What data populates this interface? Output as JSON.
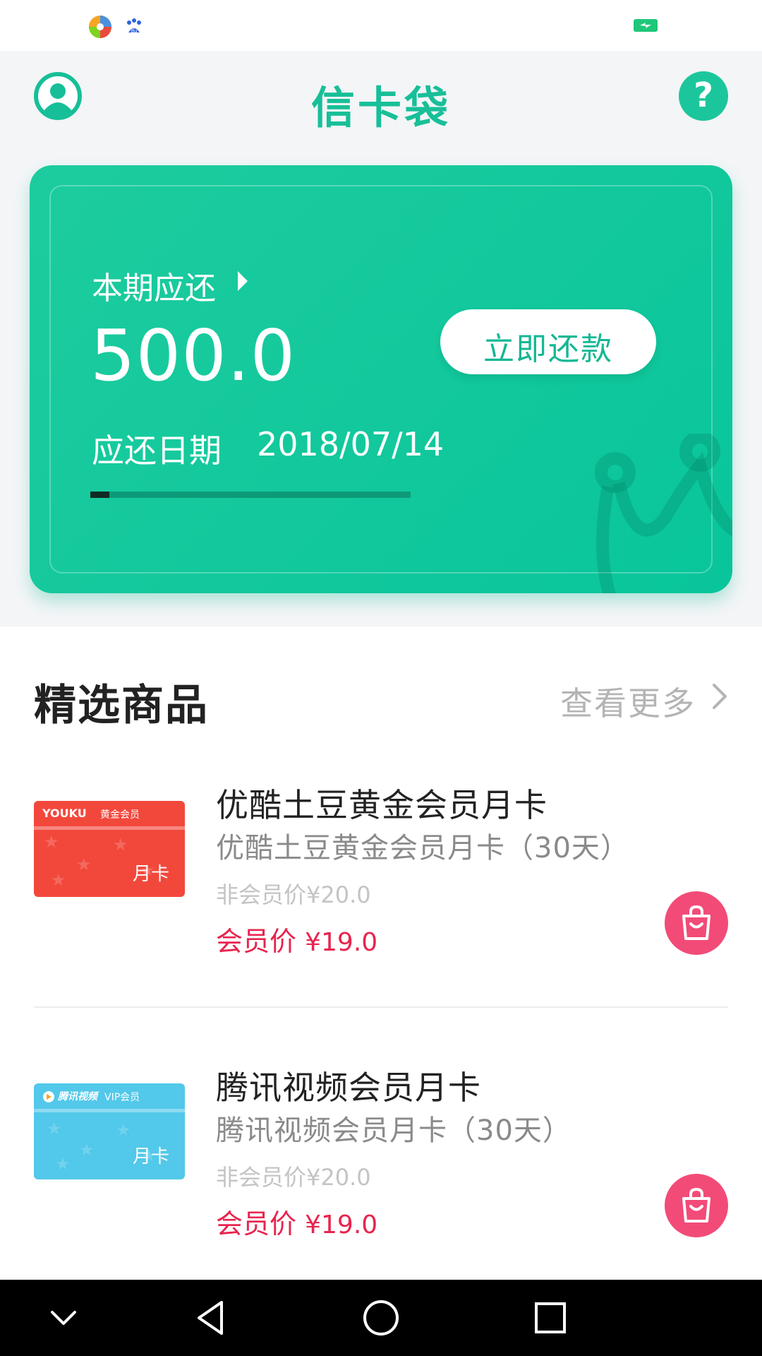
{
  "status_bar": {
    "icons": [
      "colorful-app-icon",
      "baidu-icon",
      "battery-charging-icon"
    ]
  },
  "header": {
    "title": "信卡袋",
    "profile_icon": "user-profile-icon",
    "help_label": "?"
  },
  "bill_card": {
    "due_label": "本期应还",
    "amount": "500.0",
    "due_date_label": "应还日期",
    "due_date": "2018/07/14",
    "repay_button": "立即还款",
    "progress_fraction": 0.06,
    "accent_color": "#18bf98"
  },
  "featured": {
    "title": "精选商品",
    "see_more": "查看更多",
    "products": [
      {
        "title": "优酷土豆黄金会员月卡",
        "subtitle": "优酷土豆黄金会员月卡（30天）",
        "original_price": "非会员价¥20.0",
        "member_label": "会员价",
        "member_price": "¥19.0",
        "image": {
          "brand": "YOUKU",
          "tier": "黄金会员",
          "monthly": "月卡",
          "color": "#f2483c"
        }
      },
      {
        "title": "腾讯视频会员月卡",
        "subtitle": "腾讯视频会员月卡（30天）",
        "original_price": "非会员价¥20.0",
        "member_label": "会员价",
        "member_price": "¥19.0",
        "image": {
          "brand": "腾讯视频",
          "tier": "VIP会员",
          "monthly": "月卡",
          "color": "#52c8ea"
        }
      }
    ]
  },
  "nav_bar": {
    "buttons": [
      "collapse-chevron-icon",
      "back-triangle-icon",
      "home-circle-icon",
      "recents-square-icon"
    ]
  }
}
